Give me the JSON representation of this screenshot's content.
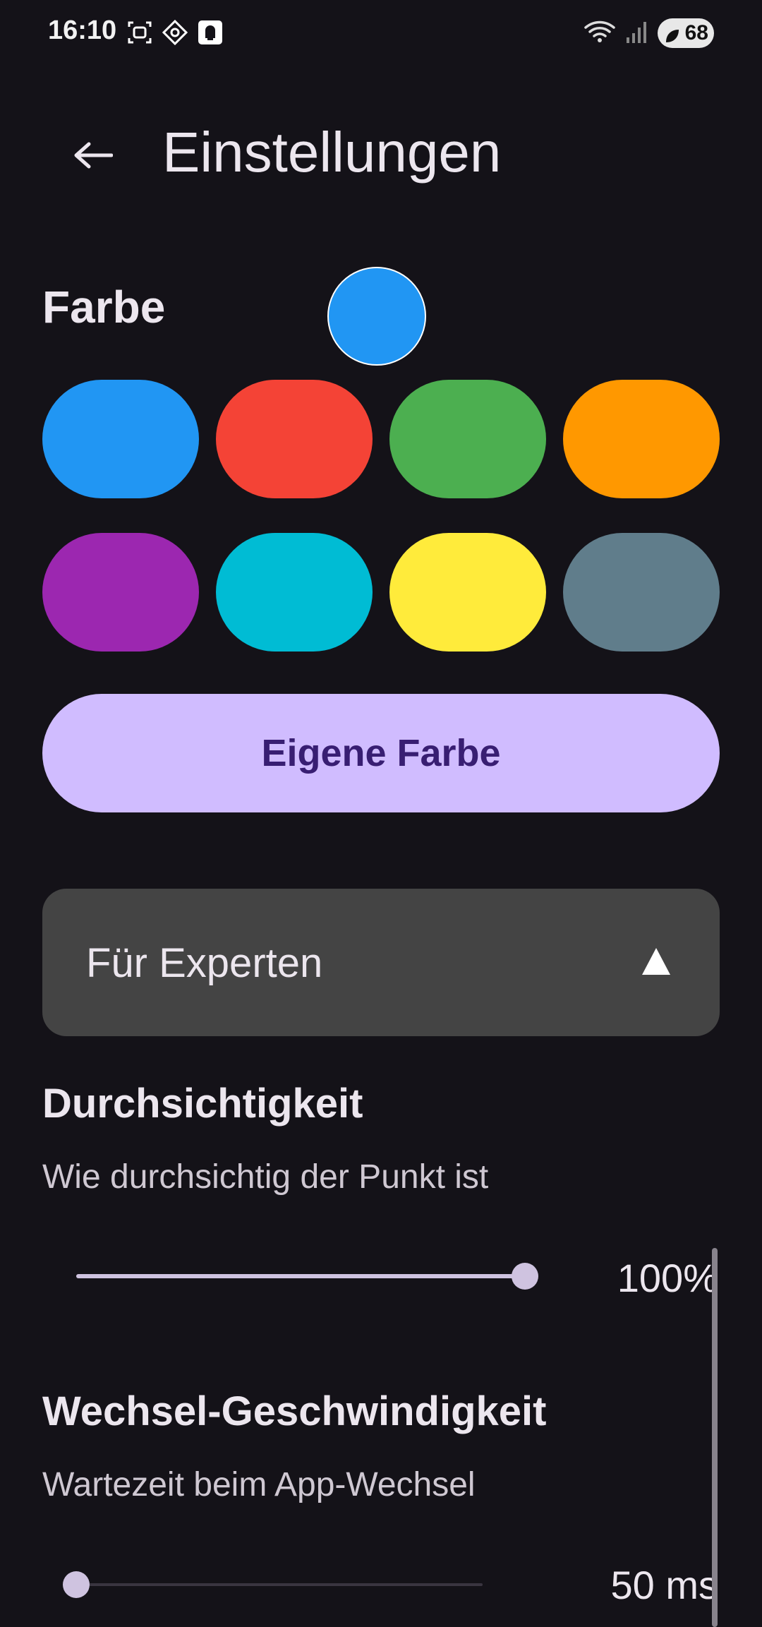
{
  "status_bar": {
    "time": "16:10",
    "battery": "68",
    "icons_left": [
      "screenshot-icon",
      "scan-icon",
      "notification-app-icon"
    ],
    "icons_right": [
      "wifi-icon",
      "signal-icon",
      "battery-icon"
    ]
  },
  "header": {
    "back_icon": "arrow-left-icon",
    "title": "Einstellungen"
  },
  "color_section": {
    "label": "Farbe",
    "selected_color": "#2196f3",
    "swatches": [
      {
        "name": "blue",
        "color": "#2196f3"
      },
      {
        "name": "red",
        "color": "#f44336"
      },
      {
        "name": "green",
        "color": "#4caf50"
      },
      {
        "name": "orange",
        "color": "#ff9800"
      },
      {
        "name": "purple",
        "color": "#9c27b0"
      },
      {
        "name": "cyan",
        "color": "#00bcd4"
      },
      {
        "name": "yellow",
        "color": "#ffeb3b"
      },
      {
        "name": "blue-grey",
        "color": "#607d8b"
      }
    ],
    "custom_button_label": "Eigene Farbe"
  },
  "expert_panel": {
    "label": "Für Experten",
    "expanded": true,
    "arrow_icon": "triangle-up-icon"
  },
  "opacity_setting": {
    "title": "Durchsichtigkeit",
    "description": "Wie durchsichtig der Punkt ist",
    "value_fraction": 1.0,
    "value_label": "100%"
  },
  "switch_speed_setting": {
    "title": "Wechsel-Geschwindigkeit",
    "description": "Wartezeit beim App-Wechsel",
    "value_fraction": 0.0,
    "value_label": "50 ms"
  }
}
